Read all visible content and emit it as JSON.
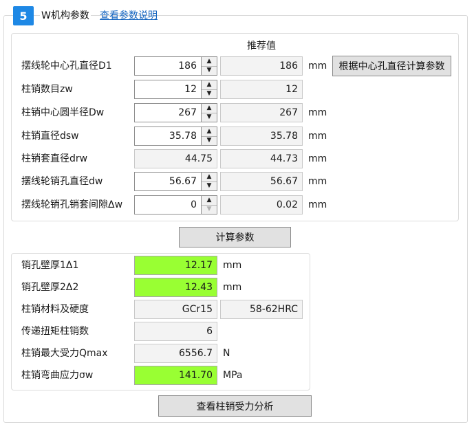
{
  "section": {
    "number": "5",
    "title": "W机构参数",
    "link": "查看参数说明"
  },
  "params": {
    "recommended_header": "推荐值",
    "rows": [
      {
        "label": "摆线轮中心孔直径D1",
        "value": "186",
        "recommended": "186",
        "unit": "mm"
      },
      {
        "label": "柱销数目zw",
        "value": "12",
        "recommended": "12",
        "unit": ""
      },
      {
        "label": "柱销中心圆半径Dw",
        "value": "267",
        "recommended": "267",
        "unit": "mm"
      },
      {
        "label": "柱销直径dsw",
        "value": "35.78",
        "recommended": "35.78",
        "unit": "mm"
      },
      {
        "label": "柱销套直径drw",
        "value": "44.75",
        "recommended": "44.73",
        "unit": "mm"
      },
      {
        "label": "摆线轮销孔直径dw",
        "value": "56.67",
        "recommended": "56.67",
        "unit": "mm"
      },
      {
        "label": "摆线轮销孔销套间隙Δw",
        "value": "0",
        "recommended": "0.02",
        "unit": "mm"
      }
    ],
    "calc_from_center_button": "根据中心孔直径计算参数"
  },
  "calc_button": "计算参数",
  "results": {
    "rows": [
      {
        "label": "销孔壁厚1Δ1",
        "value": "12.17",
        "unit": "mm"
      },
      {
        "label": "销孔壁厚2Δ2",
        "value": "12.43",
        "unit": "mm"
      },
      {
        "label": "柱销材料及硬度",
        "value": "GCr15",
        "value2": "58-62HRC"
      },
      {
        "label": "传递扭矩柱销数",
        "value": "6"
      },
      {
        "label": "柱销最大受力Qmax",
        "value": "6556.7",
        "unit": "N"
      },
      {
        "label": "柱销弯曲应力σw",
        "value": "141.70",
        "unit": "MPa"
      }
    ]
  },
  "analysis_button": "查看柱销受力分析",
  "colors": {
    "badge": "#1e88e5",
    "link": "#1565c0",
    "highlight_green": "#99ff33",
    "readonly_bg": "#f3f3f3",
    "button_bg": "#e1e1e1"
  },
  "icons": {
    "spin_up": "triangle-up",
    "spin_down": "triangle-down"
  }
}
